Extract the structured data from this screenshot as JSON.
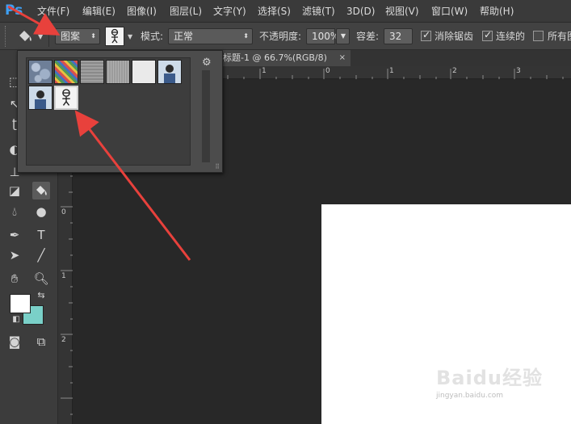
{
  "app": {
    "logo": "Ps"
  },
  "menu": [
    "文件(F)",
    "编辑(E)",
    "图像(I)",
    "图层(L)",
    "文字(Y)",
    "选择(S)",
    "滤镜(T)",
    "3D(D)",
    "视图(V)",
    "窗口(W)",
    "帮助(H)"
  ],
  "options": {
    "fill_source": "图案",
    "mode_label": "模式:",
    "mode_value": "正常",
    "opacity_label": "不透明度:",
    "opacity_value": "100%",
    "tolerance_label": "容差:",
    "tolerance_value": "32",
    "antialias_label": "消除锯齿",
    "antialias_checked": true,
    "contiguous_label": "连续的",
    "contiguous_checked": true,
    "all_layers_label": "所有图",
    "all_layers_checked": false
  },
  "document_tab": {
    "title": "标题-1 @ 66.7%(RGB/8)",
    "close": "×"
  },
  "rulers": {
    "horizontal": [
      "1",
      "0",
      "1",
      "2",
      "3"
    ],
    "vertical": [
      "0",
      "1",
      "2"
    ]
  },
  "pattern_picker": {
    "patterns": [
      {
        "name": "bubbles",
        "color": "#7f8fa6"
      },
      {
        "name": "rainbow-weave",
        "color": "#5a7fbf"
      },
      {
        "name": "gray-noise",
        "color": "#8f8f8f"
      },
      {
        "name": "gray-granite",
        "color": "#a3a3a3"
      },
      {
        "name": "white-paper",
        "color": "#e8e8e8"
      },
      {
        "name": "portrait-photo-1",
        "color": "#c9d6e4"
      },
      {
        "name": "portrait-photo-2",
        "color": "#c9d6e4"
      },
      {
        "name": "sketch-figure",
        "color": "#f4f4f4"
      }
    ],
    "selected_index": 7
  },
  "colors": {
    "foreground": "#ffffff",
    "background": "#7ad0c8",
    "accent_arrow": "#e8413c"
  },
  "watermark": {
    "logo": "Baidu经验",
    "sub": "jingyan.baidu.com"
  }
}
